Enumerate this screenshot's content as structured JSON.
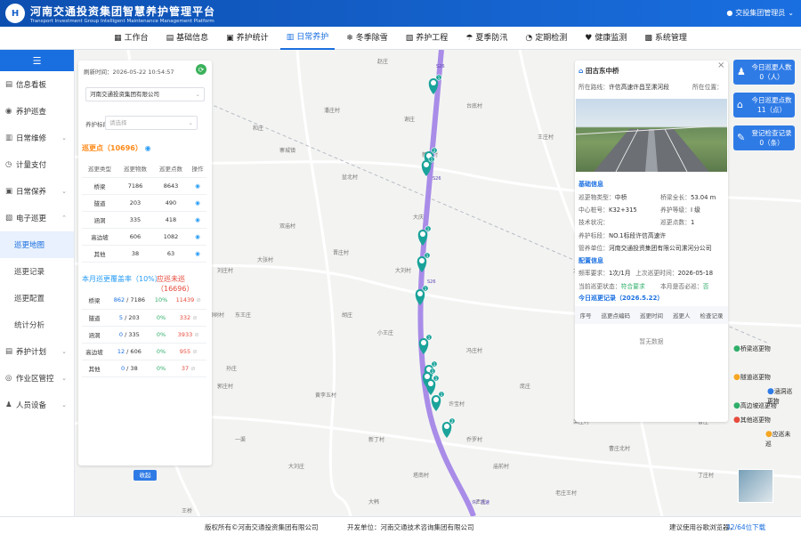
{
  "header": {
    "logo_char": "H",
    "title_cn": "河南交通投资集团智慧养护管理平台",
    "title_en": "Transport Investment Group Intelligent Maintenance Management Platform",
    "user": "交投集团管理员"
  },
  "nav": [
    {
      "icon": "▦",
      "label": "工作台"
    },
    {
      "icon": "▤",
      "label": "基础信息"
    },
    {
      "icon": "▣",
      "label": "养护统计"
    },
    {
      "icon": "▥",
      "label": "日常养护"
    },
    {
      "icon": "❄",
      "label": "冬季除雪"
    },
    {
      "icon": "▧",
      "label": "养护工程"
    },
    {
      "icon": "☂",
      "label": "夏季防汛"
    },
    {
      "icon": "◔",
      "label": "定期检测"
    },
    {
      "icon": "♥",
      "label": "健康监测"
    },
    {
      "icon": "▩",
      "label": "系统管理"
    }
  ],
  "sidebar": {
    "toggle_icon": "☰",
    "items": [
      {
        "icon": "▤",
        "label": "信息看板",
        "arrow": ""
      },
      {
        "icon": "◉",
        "label": "养护巡查",
        "arrow": ""
      },
      {
        "icon": "▥",
        "label": "日常维修",
        "arrow": "⌄"
      },
      {
        "icon": "◷",
        "label": "计量支付",
        "arrow": ""
      },
      {
        "icon": "▣",
        "label": "日常保养",
        "arrow": "⌄"
      },
      {
        "icon": "▧",
        "label": "电子巡更",
        "arrow": "⌃"
      }
    ],
    "sub_items": [
      "巡更地图",
      "巡更记录",
      "巡更配置",
      "统计分析"
    ],
    "items2": [
      {
        "icon": "▤",
        "label": "养护计划",
        "arrow": "⌄"
      },
      {
        "icon": "◎",
        "label": "作业区管控",
        "arrow": "⌄"
      },
      {
        "icon": "♟",
        "label": "人员设备",
        "arrow": "⌄"
      }
    ]
  },
  "left_panel": {
    "refresh_label": "刷新时间：",
    "refresh_time": "2026-05-22 10:54:57",
    "refresh_icon": "⟳",
    "company": "河南交通投资集团有限公司",
    "section_label": "养护标段：",
    "section_placeholder": "请选择",
    "points_title": "巡更点（10696）",
    "points_headers": [
      "巡更类型",
      "巡更物数",
      "巡更点数",
      "操作"
    ],
    "points_rows": [
      {
        "type": "桥梁",
        "objects": "7186",
        "points": "8643"
      },
      {
        "type": "隧道",
        "objects": "203",
        "points": "490"
      },
      {
        "type": "涵洞",
        "objects": "335",
        "points": "418"
      },
      {
        "type": "高边坡",
        "objects": "606",
        "points": "1082"
      },
      {
        "type": "其他",
        "objects": "38",
        "points": "63"
      }
    ],
    "coverage_title": "本月巡更覆盖率（10%）",
    "due_title": "应巡未巡（16696）",
    "coverage_rows": [
      {
        "type": "桥梁",
        "done": "862",
        "total": " / 7186",
        "rate": "10%",
        "due": "11439"
      },
      {
        "type": "隧道",
        "done": "5",
        "total": " / 203",
        "rate": "0%",
        "due": "332"
      },
      {
        "type": "涵洞",
        "done": "0",
        "total": " / 335",
        "rate": "0%",
        "due": "3933"
      },
      {
        "type": "高边坡",
        "done": "12",
        "total": " / 606",
        "rate": "0%",
        "due": "955"
      },
      {
        "type": "其他",
        "done": "0",
        "total": " / 38",
        "rate": "0%",
        "due": "37"
      }
    ],
    "collapse_label": "收起"
  },
  "map": {
    "labels": [
      {
        "text": "赵庄"
      },
      {
        "text": "潘庄村"
      },
      {
        "text": "寨城镇"
      },
      {
        "text": "台底村"
      },
      {
        "text": "王庄村"
      },
      {
        "text": "盆北村"
      },
      {
        "text": "大张村"
      },
      {
        "text": "晋庄村"
      },
      {
        "text": "大刘村"
      },
      {
        "text": "柳树村"
      },
      {
        "text": "小王庄"
      },
      {
        "text": "一渠"
      },
      {
        "text": "新丁村"
      },
      {
        "text": "冯庄村"
      },
      {
        "text": "乔罗村"
      },
      {
        "text": "郭庄村"
      },
      {
        "text": "乔集村"
      },
      {
        "text": "大韩"
      },
      {
        "text": "许宝村"
      },
      {
        "text": "栾庄村"
      },
      {
        "text": "东王庄"
      },
      {
        "text": "大刘庄"
      },
      {
        "text": "王桥"
      },
      {
        "text": "塔南村"
      },
      {
        "text": "庙前村"
      },
      {
        "text": "老庄王村"
      },
      {
        "text": "黄李村"
      },
      {
        "text": "义聚村"
      },
      {
        "text": "曹庄北村"
      },
      {
        "text": "丁庄村"
      },
      {
        "text": "李家村"
      },
      {
        "text": "双庙村"
      },
      {
        "text": "孙庄"
      },
      {
        "text": "黄李五村"
      },
      {
        "text": "大庆村"
      },
      {
        "text": "大王村"
      },
      {
        "text": "杨庄"
      },
      {
        "text": "王家"
      },
      {
        "text": "谢庄"
      },
      {
        "text": "和庄"
      },
      {
        "text": "新刘村"
      },
      {
        "text": "胡庄"
      },
      {
        "text": "曹庄"
      },
      {
        "text": "任庄"
      },
      {
        "text": "王庄"
      },
      {
        "text": "庞庄"
      },
      {
        "text": "刘庄村"
      }
    ],
    "highway_tags": [
      "S26",
      "S26",
      "S26",
      "许广高速"
    ],
    "markers": [
      {
        "n": "1"
      },
      {
        "n": "2"
      },
      {
        "n": "1"
      },
      {
        "n": "1"
      },
      {
        "n": "1"
      },
      {
        "n": "1"
      },
      {
        "n": "1"
      },
      {
        "n": "1"
      },
      {
        "n": "1"
      },
      {
        "n": "1"
      },
      {
        "n": "1"
      },
      {
        "n": "2"
      }
    ]
  },
  "detail": {
    "icon": "⌂",
    "name": "田古东中桥",
    "close": "×",
    "route_label": "所在路线：",
    "route": "许信高速许昌至漯河段",
    "position_label": "所在位置：",
    "position": "",
    "basic_title": "基础信息",
    "type_label": "巡更物类型：",
    "type": "中桥",
    "length_label": "桥梁全长：",
    "length": "53.04 m",
    "stake_label": "中心桩号：",
    "stake": "K32+315",
    "grade_label": "养护等级：",
    "grade": "I 级",
    "tech_label": "技术状况：",
    "tech": "",
    "count_label": "巡更点数：",
    "count": "1",
    "section_label": "养护标段：",
    "section": "NO.1标段许信高速许",
    "unit_label": "管养单位：",
    "unit": "河南交通投资集团有限公司漯河分公司",
    "config_title": "配置信息",
    "freq_label": "频率要求：",
    "freq": "1次/1月",
    "last_label": "上次巡更时间：",
    "last": "2026-05-18",
    "status_label": "当前巡更状态：",
    "status": "符合要求",
    "must_label": "本月是否必巡：",
    "must": "否",
    "today_title": "今日巡更记录（2026.5.22）",
    "rec_headers": [
      "序号",
      "巡更点编码",
      "巡更时间",
      "巡更人",
      "检查记录"
    ],
    "empty": "暂无数据"
  },
  "quick": [
    {
      "icon": "♟",
      "l1": "今日巡更人数",
      "l2": "0（人）"
    },
    {
      "icon": "⌂",
      "l1": "今日巡更点数",
      "l2": "11（点）"
    },
    {
      "icon": "✎",
      "l1": "登记检查记录",
      "l2": "0（条）"
    }
  ],
  "legend": [
    {
      "label": "桥梁巡更物",
      "color": "#2fae6a"
    },
    {
      "label": "隧道巡更物",
      "color": "#f5a623"
    },
    {
      "label": "涵洞巡更物",
      "color": "#2f7be6"
    },
    {
      "label": "高边坡巡更物",
      "color": "#2fae6a"
    },
    {
      "label": "其他巡更物",
      "color": "#e64b3c"
    },
    {
      "label": "应巡未巡",
      "color": "#f5a623"
    }
  ],
  "footer": {
    "copyright": "版权所有©河南交通投资集团有限公司",
    "developer": "开发单位：河南交通技术咨询集团有限公司",
    "browser": "建议使用谷歌浏览器，",
    "download": "32/64位下载"
  },
  "colors": {
    "primary": "#1a6fe0",
    "marker": "#1aa39a",
    "highway": "#a98ce8"
  }
}
